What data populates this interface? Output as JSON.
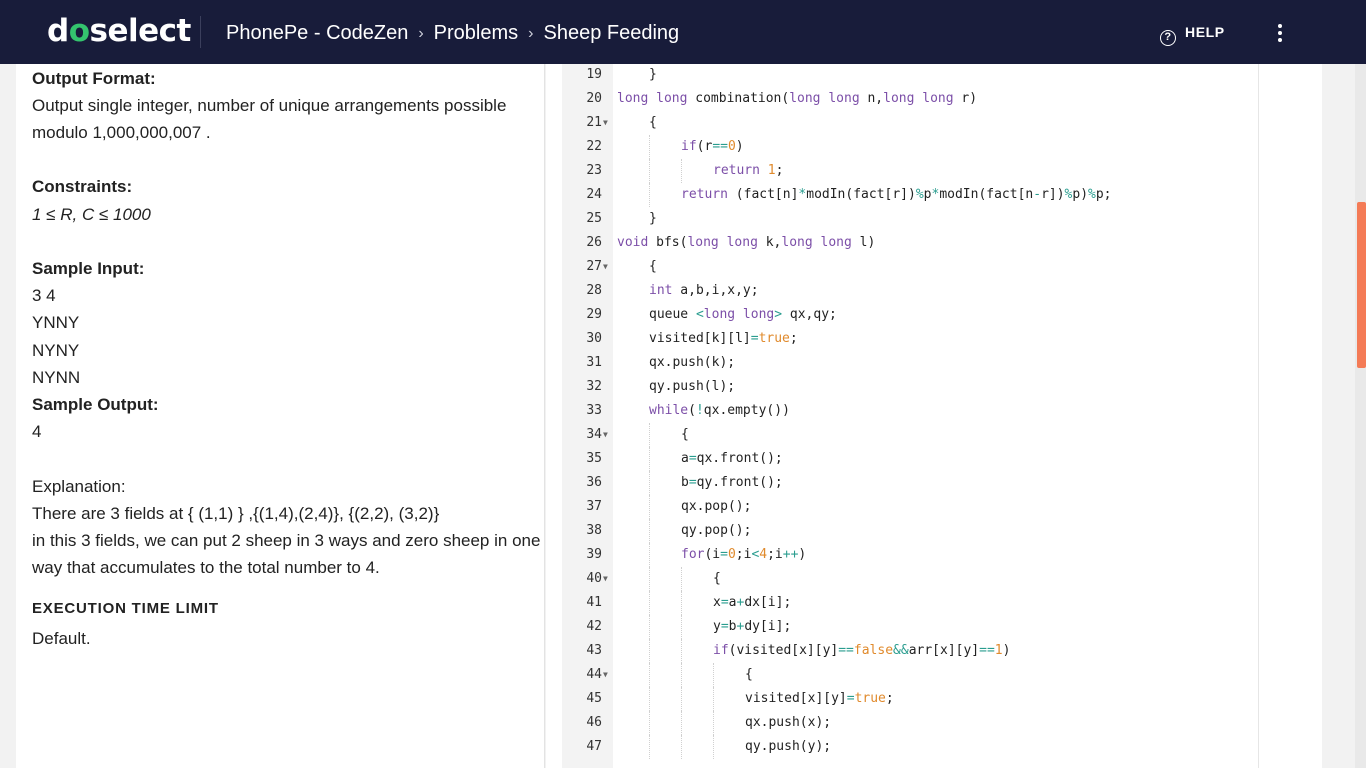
{
  "header": {
    "logo_left": "d",
    "logo_accent": "o",
    "logo_right": "select",
    "breadcrumbs": [
      "PhonePe - CodeZen",
      "Problems",
      "Sheep Feeding"
    ],
    "separator": "›",
    "help_label": "HELP"
  },
  "problem": {
    "output_format_title": "Output Format:",
    "output_format_line1": "Output single integer, number of unique arrangements possible",
    "output_format_line2": "modulo 1,000,000,007 .",
    "constraints_title": "Constraints:",
    "constraints_text": "1 ≤ R, C ≤ 1000",
    "sample_input_title": "Sample Input:",
    "sample_input_lines": [
      "3 4",
      "YNNY",
      "NYNY",
      "NYNN"
    ],
    "sample_output_title": "Sample Output:",
    "sample_output": "4",
    "explanation_title": "Explanation:",
    "explanation_line1": "There are 3 fields at { (1,1) } ,{(1,4),(2,4)}, {(2,2), (3,2)}",
    "explanation_line2": "in this 3 fields, we can put 2 sheep in 3 ways and zero sheep in one",
    "explanation_line3": "way that accumulates to the total number to 4.",
    "time_limit_title": "EXECUTION TIME LIMIT",
    "time_limit_value": "Default."
  },
  "editor": {
    "lines": [
      {
        "n": "19",
        "fold": false,
        "indent": 1,
        "tokens": [
          [
            "}",
            ""
          ]
        ]
      },
      {
        "n": "20",
        "fold": false,
        "indent": 0,
        "tokens": [
          [
            "long long",
            "kw"
          ],
          [
            " combination(",
            ""
          ],
          [
            "long long",
            "kw"
          ],
          [
            " n,",
            ""
          ],
          [
            "long long",
            "kw"
          ],
          [
            " r)",
            ""
          ]
        ]
      },
      {
        "n": "21",
        "fold": true,
        "indent": 1,
        "tokens": [
          [
            "{",
            ""
          ]
        ]
      },
      {
        "n": "22",
        "fold": false,
        "indent": 2,
        "tokens": [
          [
            "if",
            "kw"
          ],
          [
            "(r",
            ""
          ],
          [
            "==",
            "op"
          ],
          [
            "0",
            "num"
          ],
          [
            ")",
            ""
          ]
        ]
      },
      {
        "n": "23",
        "fold": false,
        "indent": 3,
        "tokens": [
          [
            "return",
            "kw"
          ],
          [
            " ",
            ""
          ],
          [
            "1",
            "num"
          ],
          [
            ";",
            ""
          ]
        ]
      },
      {
        "n": "24",
        "fold": false,
        "indent": 2,
        "tokens": [
          [
            "return",
            "kw"
          ],
          [
            " (fact[n]",
            ""
          ],
          [
            "*",
            "op"
          ],
          [
            "modIn(fact[r])",
            ""
          ],
          [
            "%",
            "op"
          ],
          [
            "p",
            ""
          ],
          [
            "*",
            "op"
          ],
          [
            "modIn(fact[n",
            ""
          ],
          [
            "-",
            "op"
          ],
          [
            "r])",
            ""
          ],
          [
            "%",
            "op"
          ],
          [
            "p)",
            ""
          ],
          [
            "%",
            "op"
          ],
          [
            "p;",
            ""
          ]
        ]
      },
      {
        "n": "25",
        "fold": false,
        "indent": 1,
        "tokens": [
          [
            "}",
            ""
          ]
        ]
      },
      {
        "n": "26",
        "fold": false,
        "indent": 0,
        "tokens": [
          [
            "void",
            "kw"
          ],
          [
            " bfs(",
            ""
          ],
          [
            "long long",
            "kw"
          ],
          [
            " k,",
            ""
          ],
          [
            "long long",
            "kw"
          ],
          [
            " l)",
            ""
          ]
        ]
      },
      {
        "n": "27",
        "fold": true,
        "indent": 1,
        "tokens": [
          [
            "{",
            ""
          ]
        ]
      },
      {
        "n": "28",
        "fold": false,
        "indent": 1,
        "tokens": [
          [
            "int",
            "kw"
          ],
          [
            " a,b,i,x,y;",
            ""
          ]
        ]
      },
      {
        "n": "29",
        "fold": false,
        "indent": 1,
        "tokens": [
          [
            "queue ",
            ""
          ],
          [
            "<",
            "op"
          ],
          [
            "long long",
            "kw"
          ],
          [
            ">",
            "op"
          ],
          [
            " qx,qy;",
            ""
          ]
        ]
      },
      {
        "n": "30",
        "fold": false,
        "indent": 1,
        "tokens": [
          [
            "visited[k][l]",
            ""
          ],
          [
            "=",
            "op"
          ],
          [
            "true",
            "num"
          ],
          [
            ";",
            ""
          ]
        ]
      },
      {
        "n": "31",
        "fold": false,
        "indent": 1,
        "tokens": [
          [
            "qx.push(k);",
            ""
          ]
        ]
      },
      {
        "n": "32",
        "fold": false,
        "indent": 1,
        "tokens": [
          [
            "qy.push(l);",
            ""
          ]
        ]
      },
      {
        "n": "33",
        "fold": false,
        "indent": 1,
        "tokens": [
          [
            "while",
            "kw"
          ],
          [
            "(",
            ""
          ],
          [
            "!",
            "op"
          ],
          [
            "qx.empty())",
            ""
          ]
        ]
      },
      {
        "n": "34",
        "fold": true,
        "indent": 2,
        "tokens": [
          [
            "{",
            ""
          ]
        ]
      },
      {
        "n": "35",
        "fold": false,
        "indent": 2,
        "tokens": [
          [
            "a",
            ""
          ],
          [
            "=",
            "op"
          ],
          [
            "qx.front();",
            ""
          ]
        ]
      },
      {
        "n": "36",
        "fold": false,
        "indent": 2,
        "tokens": [
          [
            "b",
            ""
          ],
          [
            "=",
            "op"
          ],
          [
            "qy.front();",
            ""
          ]
        ]
      },
      {
        "n": "37",
        "fold": false,
        "indent": 2,
        "tokens": [
          [
            "qx.pop();",
            ""
          ]
        ]
      },
      {
        "n": "38",
        "fold": false,
        "indent": 2,
        "tokens": [
          [
            "qy.pop();",
            ""
          ]
        ]
      },
      {
        "n": "39",
        "fold": false,
        "indent": 2,
        "tokens": [
          [
            "for",
            "kw"
          ],
          [
            "(i",
            ""
          ],
          [
            "=",
            "op"
          ],
          [
            "0",
            "num"
          ],
          [
            ";i",
            ""
          ],
          [
            "<",
            "op"
          ],
          [
            "4",
            "num"
          ],
          [
            ";i",
            ""
          ],
          [
            "++",
            "op"
          ],
          [
            ")",
            ""
          ]
        ]
      },
      {
        "n": "40",
        "fold": true,
        "indent": 3,
        "tokens": [
          [
            "{",
            ""
          ]
        ]
      },
      {
        "n": "41",
        "fold": false,
        "indent": 3,
        "tokens": [
          [
            "x",
            ""
          ],
          [
            "=",
            "op"
          ],
          [
            "a",
            ""
          ],
          [
            "+",
            "op"
          ],
          [
            "dx[i];",
            ""
          ]
        ]
      },
      {
        "n": "42",
        "fold": false,
        "indent": 3,
        "tokens": [
          [
            "y",
            ""
          ],
          [
            "=",
            "op"
          ],
          [
            "b",
            ""
          ],
          [
            "+",
            "op"
          ],
          [
            "dy[i];",
            ""
          ]
        ]
      },
      {
        "n": "43",
        "fold": false,
        "indent": 3,
        "tokens": [
          [
            "if",
            "kw"
          ],
          [
            "(visited[x][y]",
            ""
          ],
          [
            "==",
            "op"
          ],
          [
            "false",
            "num"
          ],
          [
            "&&",
            "op"
          ],
          [
            "arr[x][y]",
            ""
          ],
          [
            "==",
            "op"
          ],
          [
            "1",
            "num"
          ],
          [
            ")",
            ""
          ]
        ]
      },
      {
        "n": "44",
        "fold": true,
        "indent": 4,
        "tokens": [
          [
            "{",
            ""
          ]
        ]
      },
      {
        "n": "45",
        "fold": false,
        "indent": 4,
        "tokens": [
          [
            "visited[x][y]",
            ""
          ],
          [
            "=",
            "op"
          ],
          [
            "true",
            "num"
          ],
          [
            ";",
            ""
          ]
        ]
      },
      {
        "n": "46",
        "fold": false,
        "indent": 4,
        "tokens": [
          [
            "qx.push(x);",
            ""
          ]
        ]
      },
      {
        "n": "47",
        "fold": false,
        "indent": 4,
        "tokens": [
          [
            "qy.push(y);",
            ""
          ]
        ]
      }
    ]
  },
  "colors": {
    "header_bg": "#181c3a",
    "logo_accent": "#34c46e",
    "scroll_thumb": "#f47b56"
  }
}
